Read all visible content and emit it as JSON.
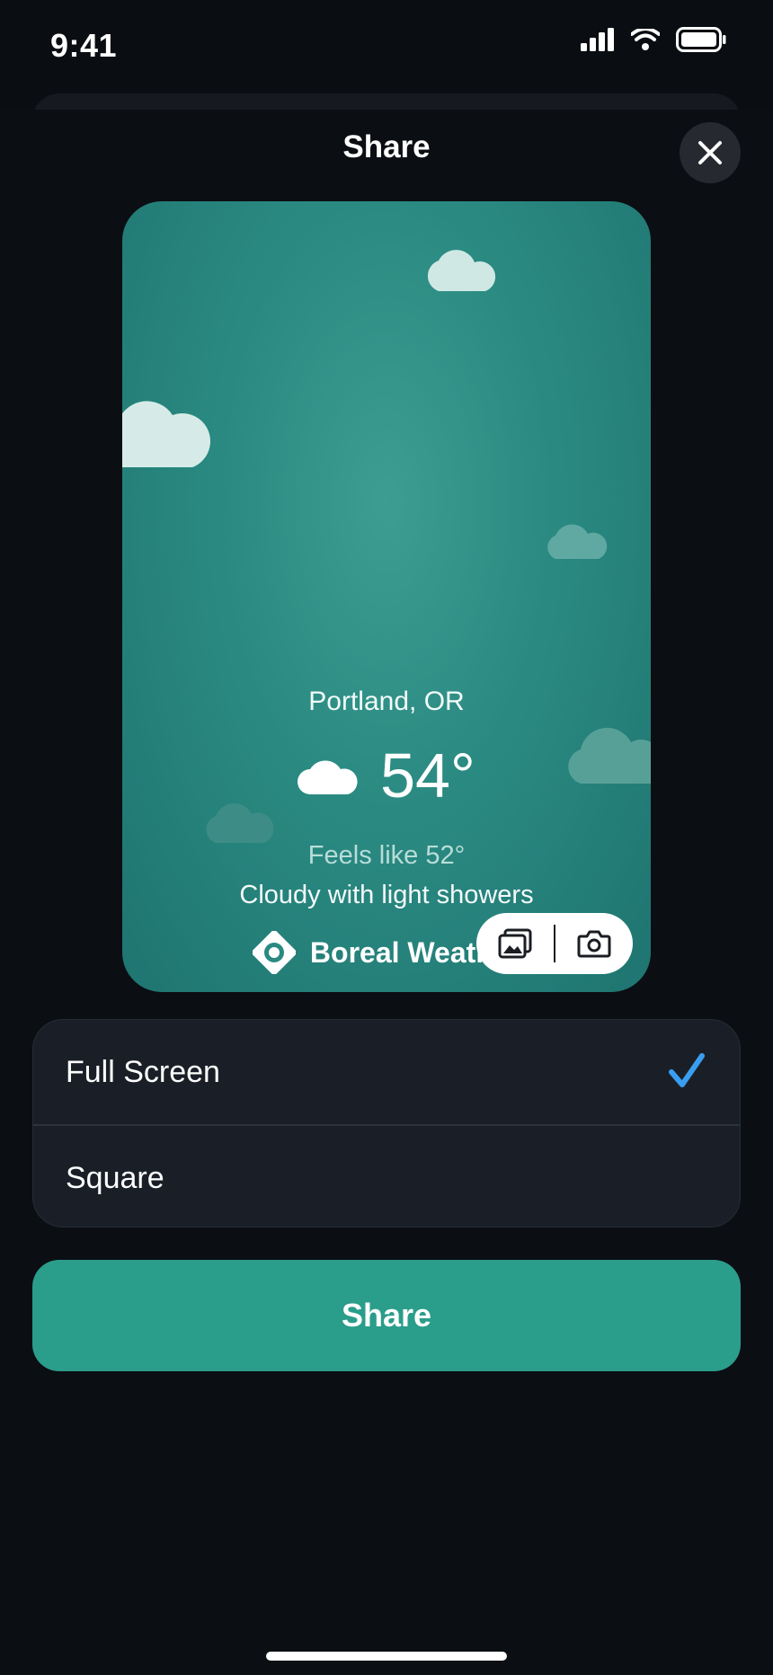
{
  "status_bar": {
    "time": "9:41"
  },
  "sheet": {
    "title": "Share"
  },
  "preview": {
    "city": "Portland, OR",
    "temperature": "54°",
    "feels_like": "Feels like 52°",
    "condition": "Cloudy with light showers",
    "brand": "Boreal Weather",
    "condition_icon": "cloud-icon",
    "actions": [
      "photos-icon",
      "camera-icon"
    ]
  },
  "options": [
    {
      "label": "Full Screen",
      "selected": true
    },
    {
      "label": "Square",
      "selected": false
    }
  ],
  "share_button": {
    "label": "Share"
  },
  "colors": {
    "accent": "#2a9d8b",
    "check": "#3a9ef0",
    "background": "#0a0d12"
  }
}
